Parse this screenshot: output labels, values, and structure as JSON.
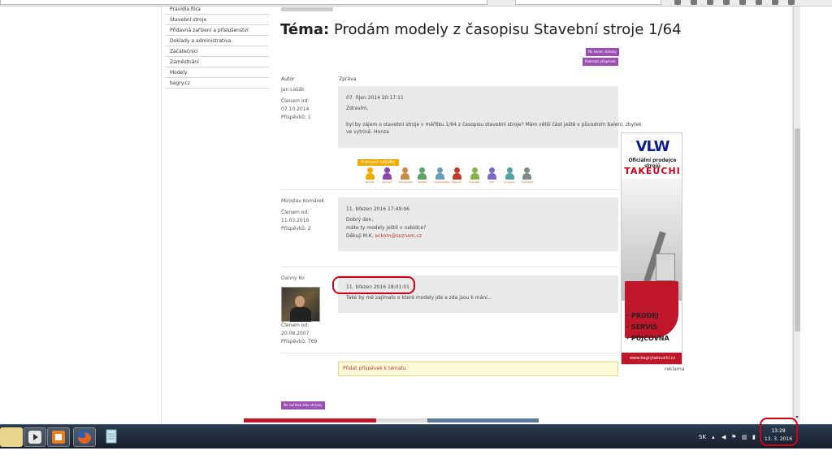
{
  "menu": {
    "items": [
      "Pravidla fóra",
      "Stavební stroje",
      "Přídavná zařízení a příslušenství",
      "Doklady a administrativa",
      "Začátečníci",
      "Zaměstnání",
      "Modely",
      "bagry.cz"
    ]
  },
  "topic": {
    "title_prefix": "Téma:",
    "title": "Prodám modely z časopisu Stavební stroje 1/64",
    "btn_end": "Na konec stránky",
    "btn_post": "Podeslat příspěvek",
    "col_author": "Autor",
    "col_message": "Zpráva"
  },
  "posts": [
    {
      "author": "Jan Lašák",
      "member_label": "Členem od:",
      "member_since": "07.10.2014",
      "posts_count": "Příspěvků: 1",
      "date": "07. říjen 2014 20:17:11",
      "lines": [
        "Zdravím,",
        "byl by zájem o stavební stroje v měřítku 1/64 z časopisu stavební stroje? Mám větší část ještě v původním balení, zbytek",
        "ve vytrině. Honza"
      ]
    },
    {
      "author": "Miroslav Komárek",
      "member_label": "Členem od:",
      "member_since": "11.03.2016",
      "posts_count": "Příspěvků: 2",
      "date": "11. březen 2016 17:49:06",
      "lines": [
        "Dobrý den,",
        "máte ty modely ještě v nabídce?",
        "Děkuji M.K. "
      ],
      "email": "eckom@seznam.cz"
    },
    {
      "author": "Danny Ko",
      "member_label": "Členem od:",
      "member_since": "20.08.2007",
      "posts_count": "Příspěvků: 769",
      "date": "11. březen 2016 18:01:01",
      "lines": [
        "Také by mě zajímalo o které modely jde a zda jsou k mání…"
      ]
    }
  ],
  "jobs": {
    "label": "Pracovní nabídky",
    "names": [
      "strojník",
      "servisní",
      "konstruktér",
      "školitel",
      "mechanizátor",
      "dispečer",
      "manažer",
      "řidič",
      "prodejce",
      "marketink"
    ],
    "colors": [
      "#f2a900",
      "#8e44ad",
      "#c98b4a",
      "#5aa36b",
      "#6a9bb8",
      "#c0392b",
      "#86b34a",
      "#7b68c8",
      "#4fa3a0",
      "#7f8c8d"
    ]
  },
  "reply_link": "Přidat příspěvek k tématu",
  "bottom_btn": "Na začátek této stránky",
  "ad": {
    "logo": "VLW",
    "tagline": "Oficiální prodejce strojů",
    "brand": "TAKEUCHI",
    "services": [
      "· PRODEJ",
      "· SERVIS",
      "· PŮJČOVNA"
    ],
    "url": "www.bagrytakeuchi.cz",
    "label": "reklama"
  },
  "taskbar": {
    "lang": "SK",
    "time": "13:28",
    "date": "13. 3. 2016"
  },
  "colors": {
    "accent_purple": "#9b4fb5",
    "highlight_red": "#d0021b",
    "message_bg": "#e9e9e9"
  }
}
